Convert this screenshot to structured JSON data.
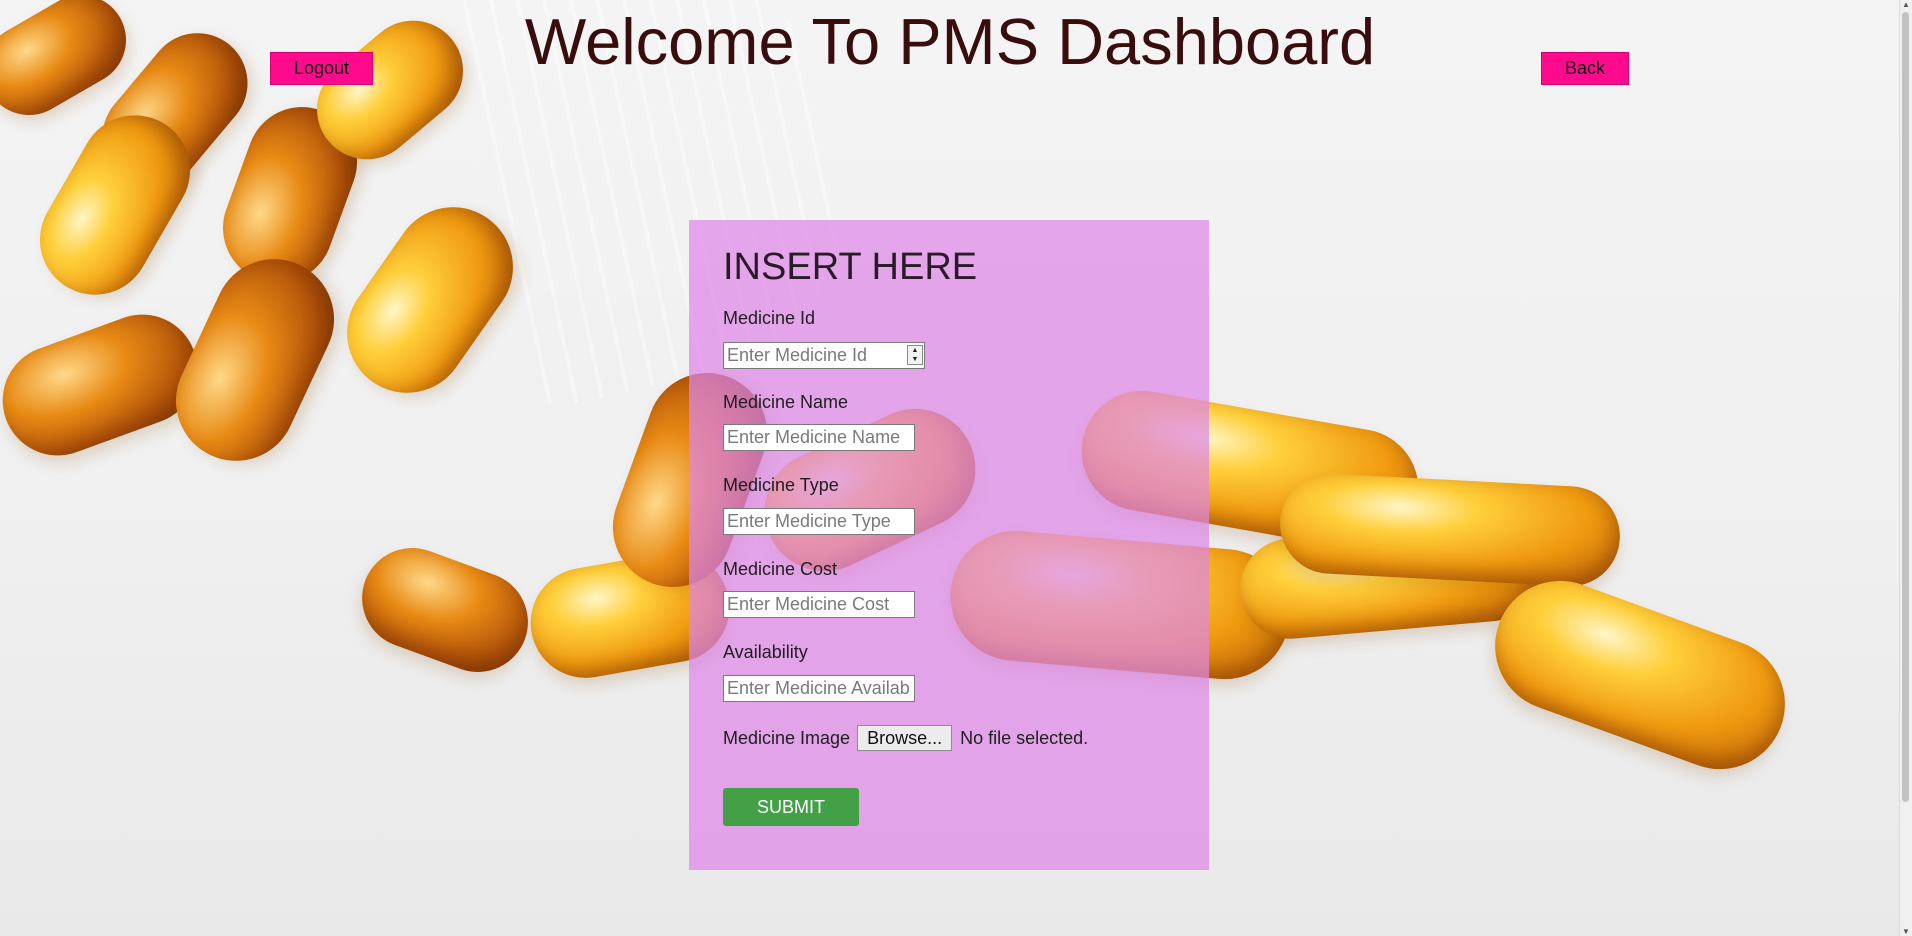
{
  "page": {
    "title": "Welcome To PMS Dashboard"
  },
  "nav": {
    "logout_label": "Logout",
    "back_label": "Back"
  },
  "form": {
    "heading": "INSERT HERE",
    "fields": [
      {
        "label": "Medicine Id",
        "placeholder": "Enter Medicine Id",
        "type": "number"
      },
      {
        "label": "Medicine Name",
        "placeholder": "Enter Medicine Name",
        "type": "text"
      },
      {
        "label": "Medicine Type",
        "placeholder": "Enter Medicine Type",
        "type": "text"
      },
      {
        "label": "Medicine Cost",
        "placeholder": "Enter Medicine Cost",
        "type": "text"
      },
      {
        "label": "Availability",
        "placeholder": "Enter Medicine Availability",
        "type": "text"
      }
    ],
    "image_label": "Medicine Image",
    "browse_label": "Browse...",
    "file_status": "No file selected.",
    "submit_label": "SUBMIT"
  },
  "colors": {
    "accent_button": "#ff0a8c",
    "panel": "#de87e6",
    "submit": "#43a047",
    "title": "#3a0d0d"
  },
  "icons": {
    "spinner": "number-spinner-icon",
    "scroll_up": "scroll-up-arrow-icon",
    "scroll_down": "scroll-down-arrow-icon"
  }
}
